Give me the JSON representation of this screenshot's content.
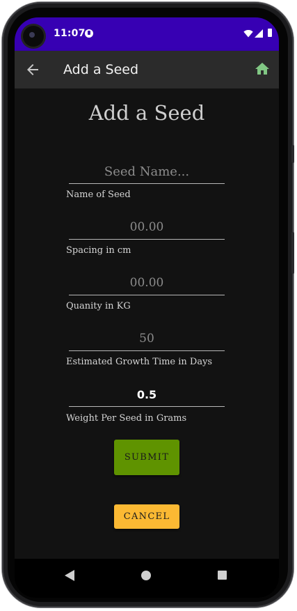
{
  "status_bar": {
    "time": "11:07",
    "app_icon": "notification-app-icon",
    "wifi_icon": "wifi-icon",
    "signal_icon": "cell-signal-icon",
    "battery_icon": "battery-icon",
    "background_color": "#3700b3"
  },
  "app_bar": {
    "back_icon": "arrow-back-icon",
    "title": "Add a Seed",
    "home_icon": "home-icon",
    "home_color": "#81c784"
  },
  "form": {
    "heading": "Add a Seed",
    "fields": [
      {
        "placeholder": "Seed Name...",
        "value": "",
        "label": "Name of Seed"
      },
      {
        "placeholder": "00.00",
        "value": "",
        "label": "Spacing in cm"
      },
      {
        "placeholder": "00.00",
        "value": "",
        "label": "Quanity in KG"
      },
      {
        "placeholder": "50",
        "value": "",
        "label": "Estimated Growth Time in Days"
      },
      {
        "placeholder": "",
        "value": "0.5",
        "label": "Weight Per Seed in Grams"
      }
    ],
    "submit_label": "SUBMIT",
    "submit_color": "#5f9300",
    "cancel_label": "CANCEL",
    "cancel_color": "#fbb933"
  },
  "nav_bar": {
    "back_icon": "nav-back-icon",
    "home_icon": "nav-home-icon",
    "recents_icon": "nav-recents-icon"
  }
}
